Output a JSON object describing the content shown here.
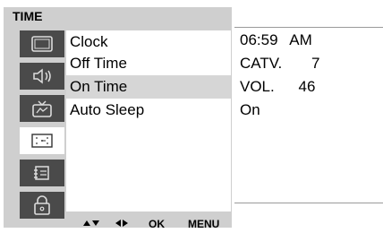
{
  "menu_title": "TIME",
  "sidebar": {
    "items": [
      {
        "icon": "screen-icon",
        "active": false
      },
      {
        "icon": "speaker-icon",
        "active": false
      },
      {
        "icon": "tv-icon",
        "active": false
      },
      {
        "icon": "clock-icon",
        "active": true
      },
      {
        "icon": "settings-icon",
        "active": false
      },
      {
        "icon": "lock-icon",
        "active": false
      }
    ]
  },
  "menu": {
    "items": [
      {
        "label": "Clock"
      },
      {
        "label": "Off Time"
      },
      {
        "label": "On Time",
        "selected": true
      },
      {
        "label": "Auto Sleep"
      }
    ]
  },
  "values": {
    "clock": {
      "time": "06:59",
      "ampm": "AM"
    },
    "input": {
      "label": "CATV.",
      "value": "7"
    },
    "volume": {
      "label": "VOL.",
      "value": "46"
    },
    "auto_sleep": "On"
  },
  "hints": {
    "ok": "OK",
    "menu": "MENU"
  },
  "colors": {
    "panel_bg": "#cfcfcf",
    "sidebar_bg": "#4a4a4a",
    "selected_bg": "#d6d6d6"
  }
}
